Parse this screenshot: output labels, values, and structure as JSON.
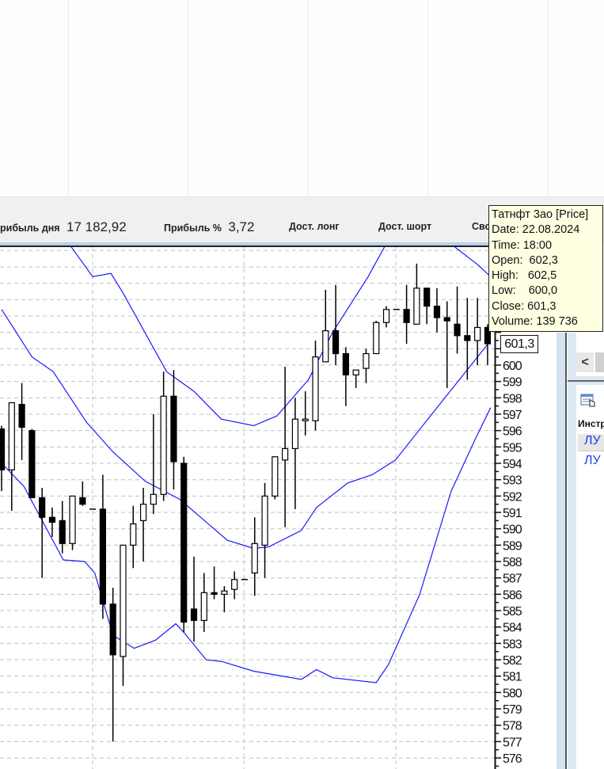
{
  "info_bar": {
    "items": [
      {
        "label": "рибыль дня",
        "value": "17 182,92"
      },
      {
        "label": "Прибыль %",
        "value": "3,72"
      },
      {
        "label": "Дост. лонг",
        "value": ""
      },
      {
        "label": "Дост. шорт",
        "value": ""
      },
      {
        "label": "Сво",
        "value": ""
      }
    ]
  },
  "tooltip": {
    "title": "Татнфт 3ао [Price]",
    "date": "Date: 22.08.2024",
    "time": "Time: 18:00",
    "open": "Open:  602,3",
    "high": "High:   602,5",
    "low": "Low:    600,0",
    "close": "Close: 601,3",
    "volume": "Volume: 139 736"
  },
  "price_marker": "601,3",
  "right_panel": {
    "scroll_left": "<",
    "header": "Инстр",
    "rows": [
      "ЛУ",
      "ЛУ"
    ]
  },
  "colors": {
    "band": "#1a1aff",
    "bull": "#ffffff",
    "bear": "#000000",
    "grid": "#c0c0c0"
  },
  "chart_data": {
    "type": "candlestick",
    "ylim": [
      575.5,
      607.2
    ],
    "y_tick_labels": [
      576,
      577,
      578,
      579,
      580,
      581,
      582,
      583,
      584,
      585,
      586,
      587,
      588,
      589,
      590,
      591,
      592,
      593,
      594,
      595,
      596,
      597,
      598,
      599,
      600
    ],
    "grid": true,
    "candles": [
      [
        596.1,
        596.3,
        592.3,
        593.6
      ],
      [
        593.6,
        597.7,
        591.1,
        597.7
      ],
      [
        597.6,
        598.9,
        594.2,
        596.2
      ],
      [
        596.0,
        596.1,
        591.9,
        591.9
      ],
      [
        591.9,
        592.5,
        587.0,
        590.7
      ],
      [
        590.7,
        591.3,
        589.5,
        590.4
      ],
      [
        590.5,
        591.7,
        588.5,
        589.1
      ],
      [
        589.1,
        592.0,
        588.7,
        592.0
      ],
      [
        591.9,
        592.9,
        591.4,
        591.5
      ],
      [
        591.2,
        591.2,
        591.2,
        591.2
      ],
      [
        591.2,
        593.3,
        584.5,
        585.4
      ],
      [
        585.4,
        586.4,
        577.0,
        582.3
      ],
      [
        582.2,
        589.0,
        580.4,
        589.0
      ],
      [
        589.0,
        591.4,
        587.6,
        590.3
      ],
      [
        590.5,
        592.5,
        588.0,
        591.5
      ],
      [
        591.5,
        597.0,
        590.9,
        592.1
      ],
      [
        592.1,
        599.6,
        591.7,
        598.1
      ],
      [
        598.1,
        599.7,
        592.4,
        594.1
      ],
      [
        594.0,
        594.4,
        583.7,
        584.3
      ],
      [
        585.1,
        588.3,
        583.1,
        584.4
      ],
      [
        584.4,
        587.3,
        583.7,
        586.1
      ],
      [
        586.1,
        587.7,
        585.7,
        586.0
      ],
      [
        586.0,
        586.5,
        584.9,
        586.2
      ],
      [
        586.3,
        587.4,
        585.7,
        586.9
      ],
      [
        586.9,
        586.9,
        586.9,
        586.9
      ],
      [
        587.3,
        590.7,
        585.9,
        589.1
      ],
      [
        589.0,
        592.8,
        587.0,
        592.0
      ],
      [
        592.0,
        594.4,
        591.8,
        594.4
      ],
      [
        594.2,
        599.9,
        590.1,
        594.9
      ],
      [
        594.9,
        598.0,
        591.2,
        596.7
      ],
      [
        596.6,
        598.4,
        595.7,
        596.7
      ],
      [
        596.6,
        601.5,
        596.0,
        600.5
      ],
      [
        600.2,
        604.6,
        600.2,
        602.1
      ],
      [
        602.1,
        604.9,
        600.0,
        600.7
      ],
      [
        600.7,
        601.1,
        597.5,
        599.4
      ],
      [
        599.4,
        599.7,
        598.6,
        599.7
      ],
      [
        599.8,
        601.0,
        598.9,
        600.7
      ],
      [
        600.7,
        602.7,
        600.7,
        602.6
      ],
      [
        602.6,
        603.6,
        602.3,
        603.4
      ],
      [
        603.4,
        603.4,
        603.4,
        603.4
      ],
      [
        603.4,
        604.9,
        601.3,
        602.6
      ],
      [
        602.5,
        606.2,
        602.5,
        604.7
      ],
      [
        604.7,
        604.7,
        602.5,
        603.6
      ],
      [
        603.6,
        604.7,
        602.0,
        602.9
      ],
      [
        602.9,
        603.9,
        598.6,
        602.7
      ],
      [
        602.5,
        604.8,
        600.7,
        601.8
      ],
      [
        601.8,
        604.1,
        599.1,
        601.5
      ],
      [
        601.5,
        604.1,
        600.0,
        602.3
      ],
      [
        602.3,
        602.5,
        600.0,
        601.3
      ]
    ],
    "bands": {
      "upper": [
        [
          0,
          611
        ],
        [
          6.9,
          607.2
        ],
        [
          9.0,
          605.4
        ],
        [
          10.8,
          605.6
        ],
        [
          12.0,
          604.4
        ],
        [
          16.3,
          599.6
        ],
        [
          19.0,
          598.4
        ],
        [
          21.7,
          596.7
        ],
        [
          24.9,
          596.3
        ],
        [
          27.2,
          596.9
        ],
        [
          30.3,
          599.1
        ],
        [
          32.7,
          602.0
        ],
        [
          36.2,
          605.4
        ],
        [
          37.8,
          607.2
        ],
        [
          40,
          609
        ],
        [
          43,
          609
        ],
        [
          44.8,
          607.2
        ],
        [
          47.1,
          606.1
        ],
        [
          48.3,
          605.4
        ]
      ],
      "middle": [
        [
          0,
          603.4
        ],
        [
          3.0,
          600.5
        ],
        [
          5.1,
          599.6
        ],
        [
          8.4,
          596.5
        ],
        [
          11.0,
          594.7
        ],
        [
          14.2,
          592.9
        ],
        [
          17.6,
          591.8
        ],
        [
          22.3,
          589.3
        ],
        [
          24.9,
          588.8
        ],
        [
          26.4,
          588.9
        ],
        [
          29.6,
          589.9
        ],
        [
          31.1,
          591.3
        ],
        [
          34.2,
          592.8
        ],
        [
          36.6,
          593.3
        ],
        [
          38.9,
          594.2
        ],
        [
          42.1,
          596.7
        ],
        [
          45.2,
          599.1
        ],
        [
          48.3,
          601.5
        ]
      ],
      "lower": [
        [
          0,
          594.0
        ],
        [
          2.2,
          592.6
        ],
        [
          6.1,
          588.1
        ],
        [
          8.2,
          588.0
        ],
        [
          9.2,
          587.3
        ],
        [
          11.0,
          583.5
        ],
        [
          13.1,
          582.7
        ],
        [
          15.2,
          583.2
        ],
        [
          17.2,
          584.2
        ],
        [
          18.1,
          583.6
        ],
        [
          20.2,
          582.0
        ],
        [
          21.7,
          581.9
        ],
        [
          24.9,
          581.3
        ],
        [
          29.6,
          580.8
        ],
        [
          31.1,
          581.4
        ],
        [
          32.7,
          580.9
        ],
        [
          37.0,
          580.6
        ],
        [
          38.2,
          581.7
        ],
        [
          41.3,
          586.0
        ],
        [
          44.4,
          592.3
        ],
        [
          46.8,
          595.5
        ],
        [
          48.3,
          597.4
        ]
      ]
    }
  }
}
